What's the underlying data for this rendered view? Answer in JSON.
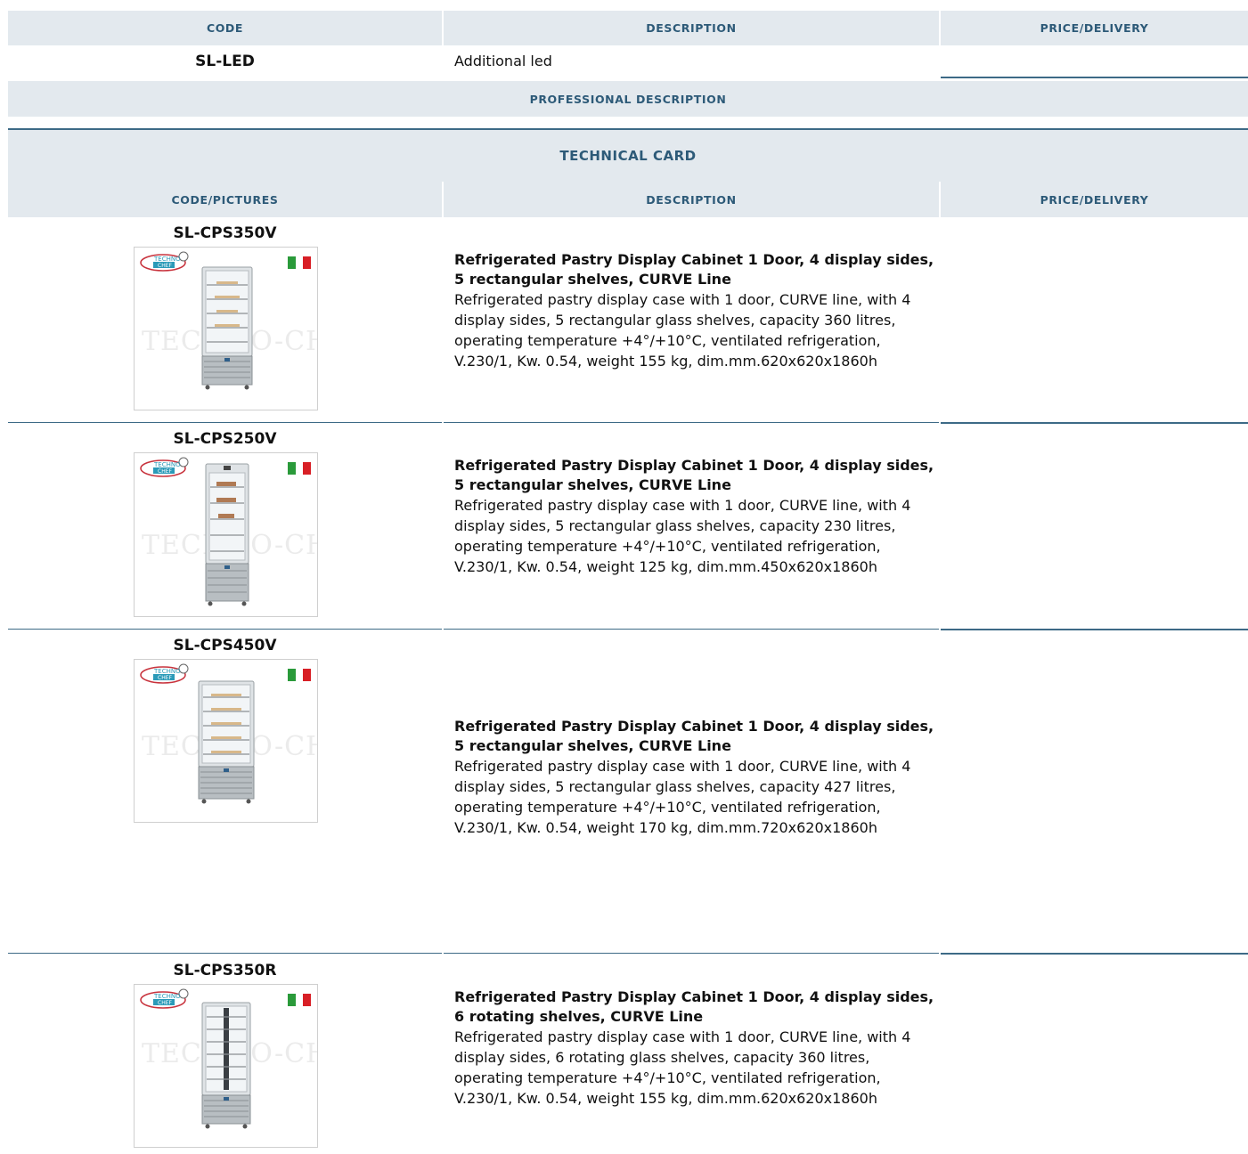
{
  "top_table": {
    "headers": [
      "CODE",
      "DESCRIPTION",
      "PRICE/DELIVERY"
    ],
    "row": {
      "code": "SL-LED",
      "description": "Additional led"
    },
    "professional_description": "PROFESSIONAL DESCRIPTION"
  },
  "technical_card": {
    "title": "TECHNICAL CARD",
    "headers": [
      "CODE/PICTURES",
      "DESCRIPTION",
      "PRICE/DELIVERY"
    ]
  },
  "products": [
    {
      "code": "SL-CPS350V",
      "title": "Refrigerated Pastry Display Cabinet 1 Door, 4 display sides, 5 rectangular shelves, CURVE Line",
      "text": "Refrigerated pastry display case with 1 door, CURVE line, with 4 display sides, 5 rectangular glass shelves, capacity 360 litres, operating temperature +4°/+10°C, ventilated refrigeration, V.230/1, Kw. 0.54, weight 155 kg, dim.mm.620x620x1860h"
    },
    {
      "code": "SL-CPS250V",
      "title": "Refrigerated Pastry Display Cabinet 1 Door, 4 display sides, 5 rectangular shelves, CURVE Line",
      "text": "Refrigerated pastry display case with 1 door, CURVE line, with 4 display sides, 5 rectangular glass shelves, capacity 230 litres, operating temperature +4°/+10°C, ventilated refrigeration, V.230/1, Kw. 0.54, weight 125 kg, dim.mm.450x620x1860h"
    },
    {
      "code": "SL-CPS450V",
      "title": "Refrigerated Pastry Display Cabinet 1 Door, 4 display sides, 5 rectangular shelves, CURVE Line",
      "text": "Refrigerated pastry display case with 1 door, CURVE line, with 4 display sides, 5 rectangular glass shelves, capacity 427 litres, operating temperature +4°/+10°C, ventilated refrigeration, V.230/1, Kw. 0.54, weight 170 kg, dim.mm.720x620x1860h"
    },
    {
      "code": "SL-CPS350R",
      "title": "Refrigerated Pastry Display Cabinet 1 Door, 4 display sides, 6 rotating shelves, CURVE Line",
      "text": "Refrigerated pastry display case with 1 door, CURVE line, with 4 display sides, 6 rotating glass shelves, capacity 360 litres, operating temperature +4°/+10°C, ventilated refrigeration, V.230/1, Kw. 0.54, weight 155 kg, dim.mm.620x620x1860h"
    }
  ],
  "image_branding": {
    "logo_text": "TECHNO CHEF",
    "watermark": "TECHNO-CHEF.IT",
    "flag_colors": [
      "#2a9a3a",
      "#ffffff",
      "#d81f26"
    ]
  }
}
